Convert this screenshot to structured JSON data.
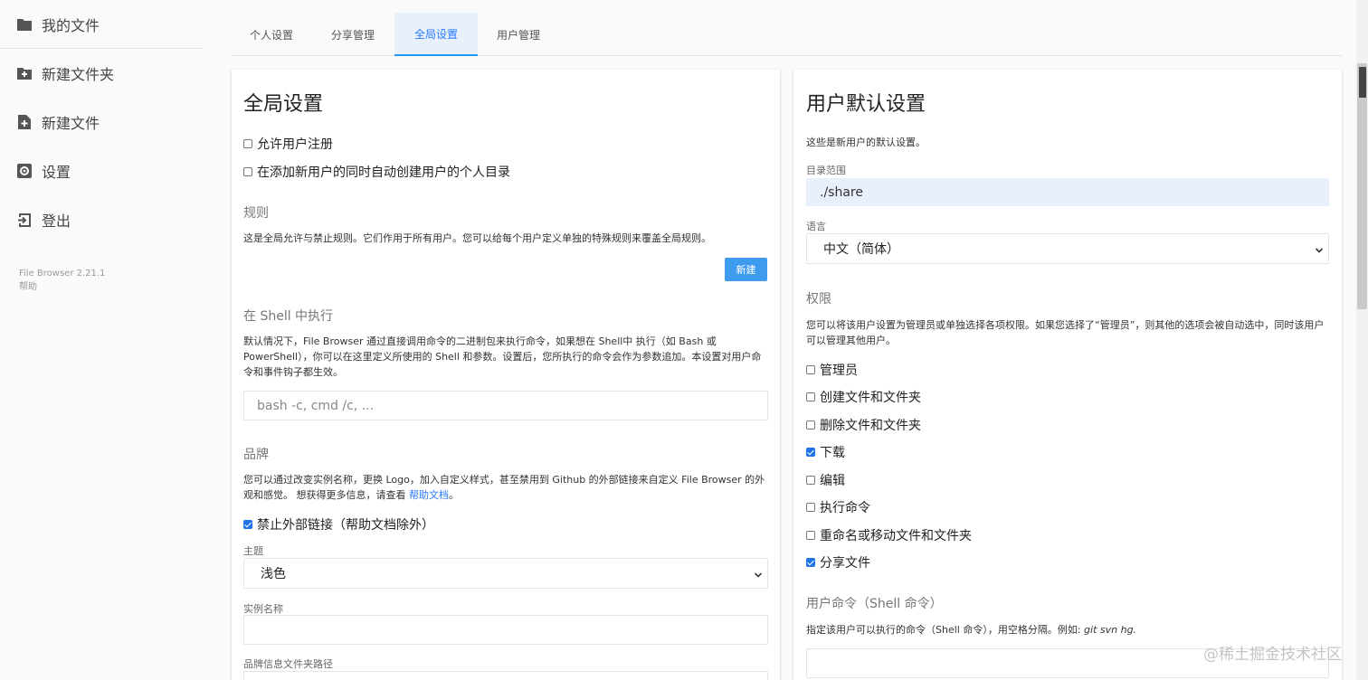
{
  "sidebar": {
    "items": [
      {
        "label": "我的文件",
        "icon": "folder-icon"
      },
      {
        "label": "新建文件夹",
        "icon": "create-folder-icon"
      },
      {
        "label": "新建文件",
        "icon": "note-add-icon"
      },
      {
        "label": "设置",
        "icon": "settings-icon"
      },
      {
        "label": "登出",
        "icon": "logout-icon"
      }
    ],
    "version": "File Browser 2.21.1",
    "help": "帮助"
  },
  "tabs": [
    {
      "label": "个人设置",
      "active": false
    },
    {
      "label": "分享管理",
      "active": false
    },
    {
      "label": "全局设置",
      "active": true
    },
    {
      "label": "用户管理",
      "active": false
    }
  ],
  "global": {
    "title": "全局设置",
    "allow_signup": {
      "label": "允许用户注册",
      "checked": false
    },
    "create_user_dir": {
      "label": "在添加新用户的同时自动创建用户的个人目录",
      "checked": false
    },
    "rules": {
      "title": "规则",
      "desc": "这是全局允许与禁止规则。它们作用于所有用户。您可以给每个用户定义单独的特殊规则来覆盖全局规则。",
      "new_button": "新建"
    },
    "shell": {
      "title": "在 Shell 中执行",
      "desc": "默认情况下，File Browser 通过直接调用命令的二进制包来执行命令，如果想在 Shell中 执行（如 Bash 或 PowerShell），你可以在这里定义所使用的 Shell 和参数。设置后，您所执行的命令会作为参数追加。本设置对用户命令和事件钩子都生效。",
      "placeholder": "bash -c, cmd /c, ..."
    },
    "branding": {
      "title": "品牌",
      "desc_pre": "您可以通过改变实例名称，更换 Logo，加入自定义样式，甚至禁用到 Github 的外部链接来自定义 File Browser 的外观和感觉。 想获得更多信息，请查看 ",
      "desc_link": "帮助文档",
      "desc_post": "。",
      "disable_external": {
        "label": "禁止外部链接（帮助文档除外）",
        "checked": true
      },
      "theme_label": "主题",
      "theme_value": "浅色",
      "instance_name_label": "实例名称",
      "instance_name_value": "",
      "branding_dir_label": "品牌信息文件夹路径"
    }
  },
  "user_defaults": {
    "title": "用户默认设置",
    "desc": "这些是新用户的默认设置。",
    "scope_label": "目录范围",
    "scope_value": "./share",
    "language_label": "语言",
    "language_value": "中文（简体）",
    "permissions": {
      "title": "权限",
      "desc": "您可以将该用户设置为管理员或单独选择各项权限。如果您选择了“管理员”，则其他的选项会被自动选中，同时该用户可以管理其他用户。",
      "items": [
        {
          "label": "管理员",
          "checked": false
        },
        {
          "label": "创建文件和文件夹",
          "checked": false
        },
        {
          "label": "删除文件和文件夹",
          "checked": false
        },
        {
          "label": "下载",
          "checked": true
        },
        {
          "label": "编辑",
          "checked": false
        },
        {
          "label": "执行命令",
          "checked": false
        },
        {
          "label": "重命名或移动文件和文件夹",
          "checked": false
        },
        {
          "label": "分享文件",
          "checked": true
        }
      ]
    },
    "commands": {
      "title": "用户命令（Shell 命令）",
      "desc_pre": "指定该用户可以执行的命令（Shell 命令），用空格分隔。例如: ",
      "example": "git svn hg.",
      "value": ""
    }
  },
  "watermark": "@稀土掘金技术社区",
  "colors": {
    "accent": "#2196f3",
    "button": "#3f9bef",
    "checkbox": "#1e73e8"
  }
}
